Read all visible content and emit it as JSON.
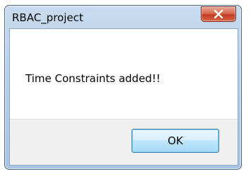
{
  "window": {
    "title": "RBAC_project"
  },
  "dialog": {
    "message": "Time Constraints added!!",
    "ok_label": "OK"
  },
  "icons": {
    "close": "close-icon"
  },
  "colors": {
    "close_button": "#c8432a",
    "ok_button_border": "#3c7fb1",
    "frame": "#b9d0e9"
  }
}
